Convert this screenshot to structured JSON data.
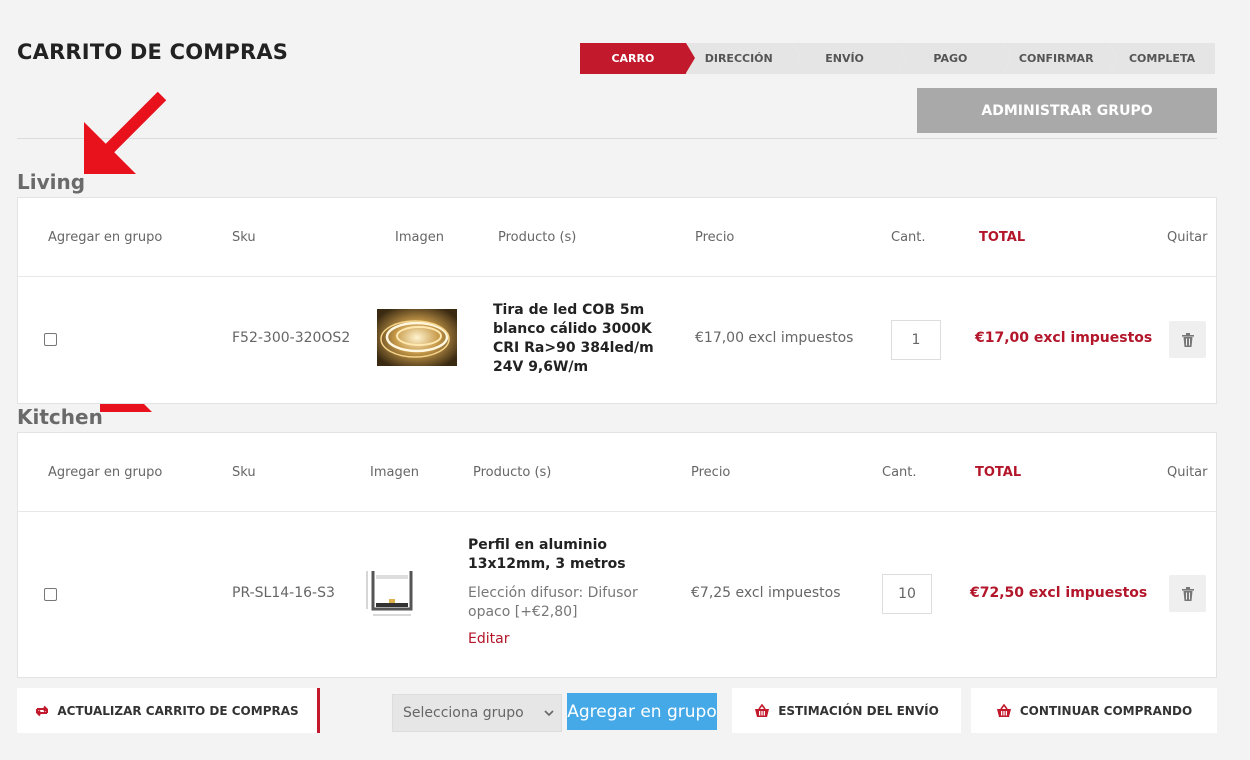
{
  "page_title": "CARRITO DE COMPRAS",
  "steps": [
    "CARRO",
    "DIRECCIÓN",
    "ENVÍO",
    "PAGO",
    "CONFIRMAR",
    "COMPLETA"
  ],
  "active_step": "CARRO",
  "admin_button": "ADMINISTRAR GRUPO",
  "columns": {
    "add": "Agregar en grupo",
    "sku": "Sku",
    "image": "Imagen",
    "product": "Producto (s)",
    "price": "Precio",
    "qty": "Cant.",
    "total": "TOTAL",
    "remove": "Quitar"
  },
  "groups": [
    {
      "name": "Living",
      "item": {
        "sku": "F52-300-320OS2",
        "name": "Tira de led COB 5m blanco cálido 3000K CRI Ra>90 384led/m 24V 9,6W/m",
        "price": "€17,00 excl impuestos",
        "qty": "1",
        "total": "€17,00 excl impuestos"
      }
    },
    {
      "name": "Kitchen",
      "item": {
        "sku": "PR-SL14-16-S3",
        "name": "Perfil en aluminio 13x12mm, 3 metros",
        "attribute": "Elección difusor: Difusor opaco [+€2,80]",
        "edit": "Editar",
        "price": "€7,25 excl impuestos",
        "qty": "10",
        "total": "€72,50 excl impuestos"
      }
    }
  ],
  "bottom": {
    "update": "ACTUALIZAR CARRITO DE COMPRAS",
    "select_placeholder": "Selecciona grupo",
    "add_group": "Agregar en grupo",
    "estimate": "ESTIMACIÓN DEL ENVÍO",
    "continue": "CONTINUAR COMPRANDO"
  },
  "colors": {
    "accent": "#c21a2c",
    "blue": "#45a9e8",
    "arrow": "#e8121c"
  }
}
